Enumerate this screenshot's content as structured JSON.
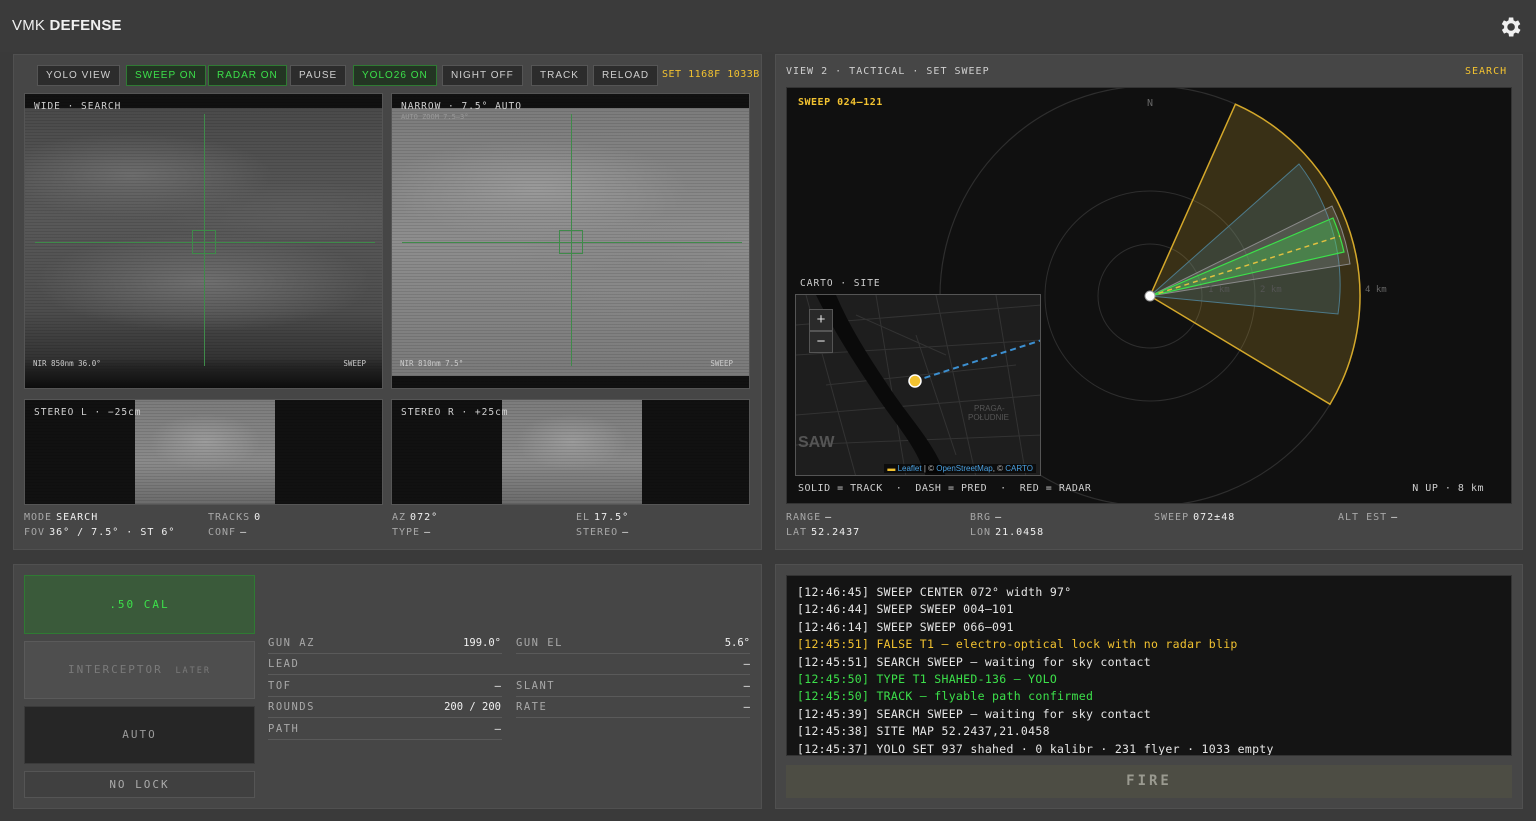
{
  "header": {
    "brand_a": "VMK",
    "brand_b": "DEFENSE",
    "settings_icon": "gear-icon"
  },
  "toolbar": {
    "buttons": [
      {
        "label": "YOLO VIEW",
        "active": false
      },
      {
        "label": "SWEEP ON",
        "active": true
      },
      {
        "label": "RADAR ON",
        "active": true
      },
      {
        "label": "PAUSE",
        "active": false
      },
      {
        "label": "YOLO26 ON",
        "active": true
      },
      {
        "label": "NIGHT OFF",
        "active": false
      },
      {
        "label": "TRACK",
        "active": false
      },
      {
        "label": "RELOAD",
        "active": false
      }
    ],
    "set_label": "SET 1168F 1033B"
  },
  "cams": {
    "wide": {
      "label": "WIDE · SEARCH",
      "foot_left": "NIR 850nm  36.0°",
      "foot_right": "SWEEP"
    },
    "narrow": {
      "label": "NARROW · 7.5° AUTO",
      "sub": "AUTO ZOOM 7.5–3°",
      "foot_left": "NIR 810nm  7.5°",
      "foot_right": "SWEEP"
    },
    "stereo_l": {
      "label": "STEREO L · −25cm"
    },
    "stereo_r": {
      "label": "STEREO R · +25cm"
    }
  },
  "stats": {
    "mode_k": "MODE",
    "mode_v": "SEARCH",
    "fov_k": "FOV",
    "fov_v": "36° / 7.5° · ST 6°",
    "tracks_k": "TRACKS",
    "tracks_v": "0",
    "conf_k": "CONF",
    "conf_v": "—",
    "az_k": "AZ",
    "az_v": "072°",
    "type_k": "TYPE",
    "type_v": "—",
    "el_k": "EL",
    "el_v": "17.5°",
    "stereo_k": "STEREO",
    "stereo_v": "—"
  },
  "tactical": {
    "title": "VIEW 2 · TACTICAL · SET SWEEP",
    "mode": "SEARCH",
    "sweep_label": "SWEEP 024–121",
    "north": "N",
    "ring_labels": [
      "1 km",
      "2 km",
      "4 km"
    ],
    "carto_label": "CARTO · SITE",
    "map_zoom_in": "+",
    "map_zoom_out": "−",
    "map_district": "PRAGA-\nPOŁUDNIE",
    "map_city_fragment": "SAW",
    "map_attrib_leaflet": "Leaflet",
    "map_attrib_osm": "OpenStreetMap",
    "map_attrib_carto": "CARTO",
    "legend": "SOLID = TRACK  ·  DASH = PRED  ·  RED = RADAR",
    "scale": "N UP · 8 km",
    "colors": {
      "sweep": "#f2c230",
      "track": "#3ce04a",
      "pred": "#4aa0e0"
    }
  },
  "telemetry": {
    "range_k": "RANGE",
    "range_v": "—",
    "brg_k": "BRG",
    "brg_v": "—",
    "sweep_k": "SWEEP",
    "sweep_v": "072±48",
    "alt_k": "ALT EST",
    "alt_v": "—",
    "lat_k": "LAT",
    "lat_v": "52.2437",
    "lon_k": "LON",
    "lon_v": "21.0458"
  },
  "weapons": {
    "cal50": ".50 CAL",
    "interceptor": "INTERCEPTOR",
    "interceptor_tag": "LATER",
    "auto": "AUTO",
    "no_lock": "NO LOCK"
  },
  "gun": {
    "gun_az_k": "GUN AZ",
    "gun_az_v": "199.0°",
    "gun_el_k": "GUN EL",
    "gun_el_v": "5.6°",
    "lead_k": "LEAD",
    "lead_v": "—",
    "tof_k": "TOF",
    "tof_v": "—",
    "slant_k": "SLANT",
    "slant_v": "—",
    "rounds_k": "ROUNDS",
    "rounds_v": "200 / 200",
    "rate_k": "RATE",
    "rate_v": "—",
    "path_k": "PATH",
    "path_v": "—"
  },
  "log": [
    {
      "text": "[12:46:45] SWEEP CENTER 072° width 97°",
      "level": "info"
    },
    {
      "text": "[12:46:44] SWEEP SWEEP 004–101",
      "level": "info"
    },
    {
      "text": "[12:46:14] SWEEP SWEEP 066–091",
      "level": "info"
    },
    {
      "text": "[12:45:51] FALSE T1 — electro-optical lock with no radar blip",
      "level": "warn"
    },
    {
      "text": "[12:45:51] SEARCH SWEEP — waiting for sky contact",
      "level": "info"
    },
    {
      "text": "[12:45:50] TYPE T1 SHAHED-136 — YOLO",
      "level": "ok"
    },
    {
      "text": "[12:45:50] TRACK — flyable path confirmed",
      "level": "ok"
    },
    {
      "text": "[12:45:39] SEARCH SWEEP — waiting for sky contact",
      "level": "info"
    },
    {
      "text": "[12:45:38] SITE MAP 52.2437,21.0458",
      "level": "info"
    },
    {
      "text": "[12:45:37] YOLO SET 937 shahed · 0 kalibr · 231 flyer · 1033 empty",
      "level": "info"
    }
  ],
  "fire_label": "FIRE"
}
